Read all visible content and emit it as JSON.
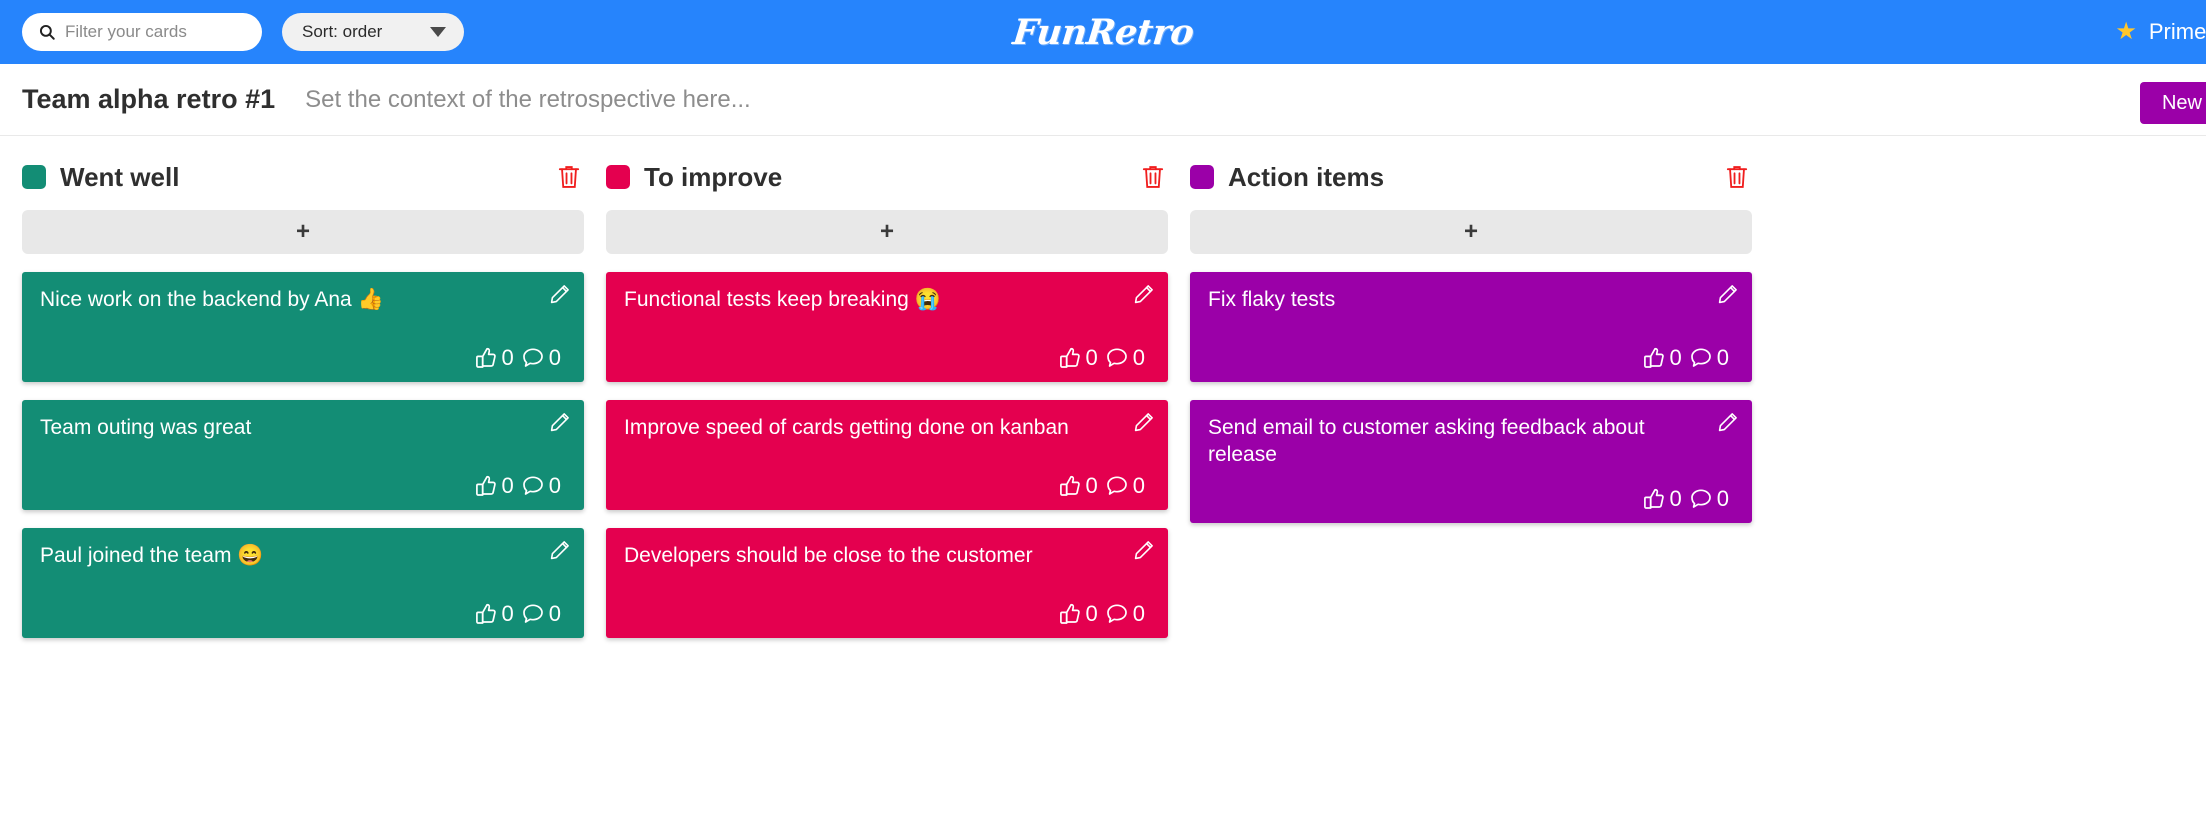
{
  "topnav": {
    "search": {
      "icon": "search-icon",
      "placeholder": "Filter your cards",
      "value": ""
    },
    "sort": {
      "label": "Sort: order",
      "icon": "chevron-down-icon"
    },
    "brand": "FunRetro",
    "right": {
      "icon": "star-icon",
      "label": "Prime Directive"
    },
    "background_color": "#2684FC"
  },
  "titlebar": {
    "board_title": "Team alpha retro #1",
    "context_placeholder": "Set the context of the retrospective here...",
    "new_column_label": "New column",
    "new_column_color": "#9B00A8"
  },
  "board": {
    "add_card_symbol": "+",
    "columns": [
      {
        "title": "Went well",
        "color": "#138D75",
        "swatch_color": "#138D75",
        "delete_icon": "trash-icon",
        "delete_icon_color": "#F01E1E",
        "cards": [
          {
            "text": "Nice work on the backend by Ana 👍",
            "votes": "0",
            "comments": "0",
            "edit_icon": "pencil-icon"
          },
          {
            "text": "Team outing was great",
            "votes": "0",
            "comments": "0",
            "edit_icon": "pencil-icon"
          },
          {
            "text": "Paul joined the team 😄",
            "votes": "0",
            "comments": "0",
            "edit_icon": "pencil-icon"
          }
        ]
      },
      {
        "title": "To improve",
        "color": "#E4004F",
        "swatch_color": "#E4004F",
        "delete_icon": "trash-icon",
        "delete_icon_color": "#F01E1E",
        "cards": [
          {
            "text": "Functional tests keep breaking 😭",
            "votes": "0",
            "comments": "0",
            "edit_icon": "pencil-icon"
          },
          {
            "text": "Improve speed of cards getting done on kanban",
            "votes": "0",
            "comments": "0",
            "edit_icon": "pencil-icon"
          },
          {
            "text": "Developers should be close to the customer",
            "votes": "0",
            "comments": "0",
            "edit_icon": "pencil-icon"
          }
        ]
      },
      {
        "title": "Action items",
        "color": "#9B00A8",
        "swatch_color": "#9B00A8",
        "delete_icon": "trash-icon",
        "delete_icon_color": "#F01E1E",
        "cards": [
          {
            "text": "Fix flaky tests",
            "votes": "0",
            "comments": "0",
            "edit_icon": "pencil-icon"
          },
          {
            "text": "Send email to customer asking feedback about release",
            "votes": "0",
            "comments": "0",
            "edit_icon": "pencil-icon"
          }
        ]
      }
    ]
  }
}
